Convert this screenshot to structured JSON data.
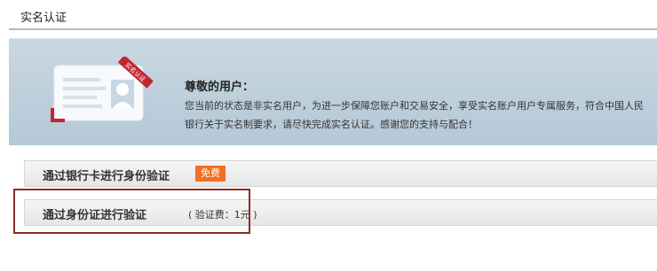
{
  "page": {
    "title": "实名认证"
  },
  "notice": {
    "illustration_icon": "id-card-icon",
    "ribbon_text": "实名认证",
    "greeting": "尊敬的用户：",
    "line1": "您当前的状态是非实名用户，为进一步保障您账户和交易安全，享受实名账户用户专属服务，符合中国人民",
    "line2": "银行关于实名制要求，请尽快完成实名认证。感谢您的支持与配合！"
  },
  "options": {
    "bank": {
      "label": "通过银行卡进行身份验证",
      "badge": "免费"
    },
    "id_card": {
      "label": "通过身份证进行验证",
      "fee": "( 验证费：1元 )"
    }
  },
  "colors": {
    "badge_bg": "#f26f21",
    "highlight_border": "#8e2a2a",
    "notice_bg": "#bccdd9"
  }
}
